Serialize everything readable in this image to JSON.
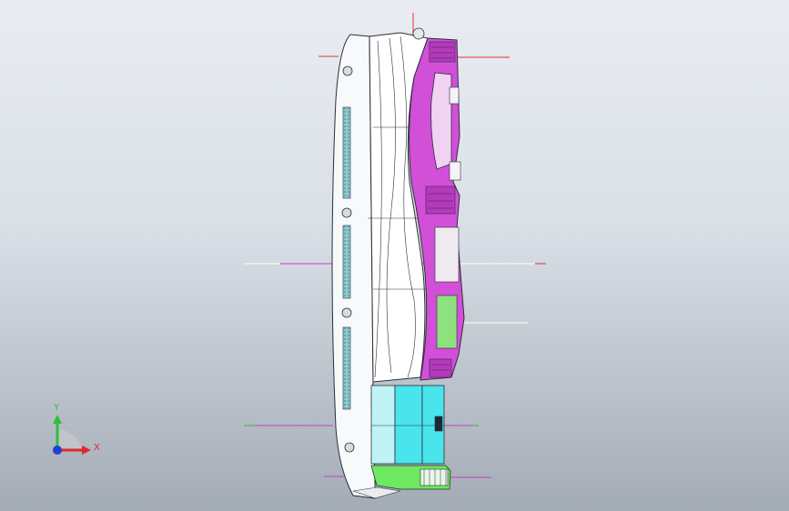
{
  "triad": {
    "y_label": "Y",
    "x_label": "X",
    "colors": {
      "x_axis": "#e3262b",
      "y_axis": "#2fbf3a",
      "z_axis": "#1f3fd6"
    }
  },
  "colors": {
    "background_top": "#e9edf2",
    "background_bottom": "#a3abb5",
    "body_white": "#f8f9fb",
    "selected_magenta": "#d24fd8",
    "panel_cyan": "#49e4ec",
    "panel_light_cyan": "#bff3f6",
    "panel_green": "#6ee860",
    "outline_dark": "#2b2f3a",
    "ref_line_red": "#e2303a",
    "ref_line_magenta": "#c43fc7",
    "ref_line_green": "#39b44a",
    "vent_teal": "#2f8f98"
  }
}
